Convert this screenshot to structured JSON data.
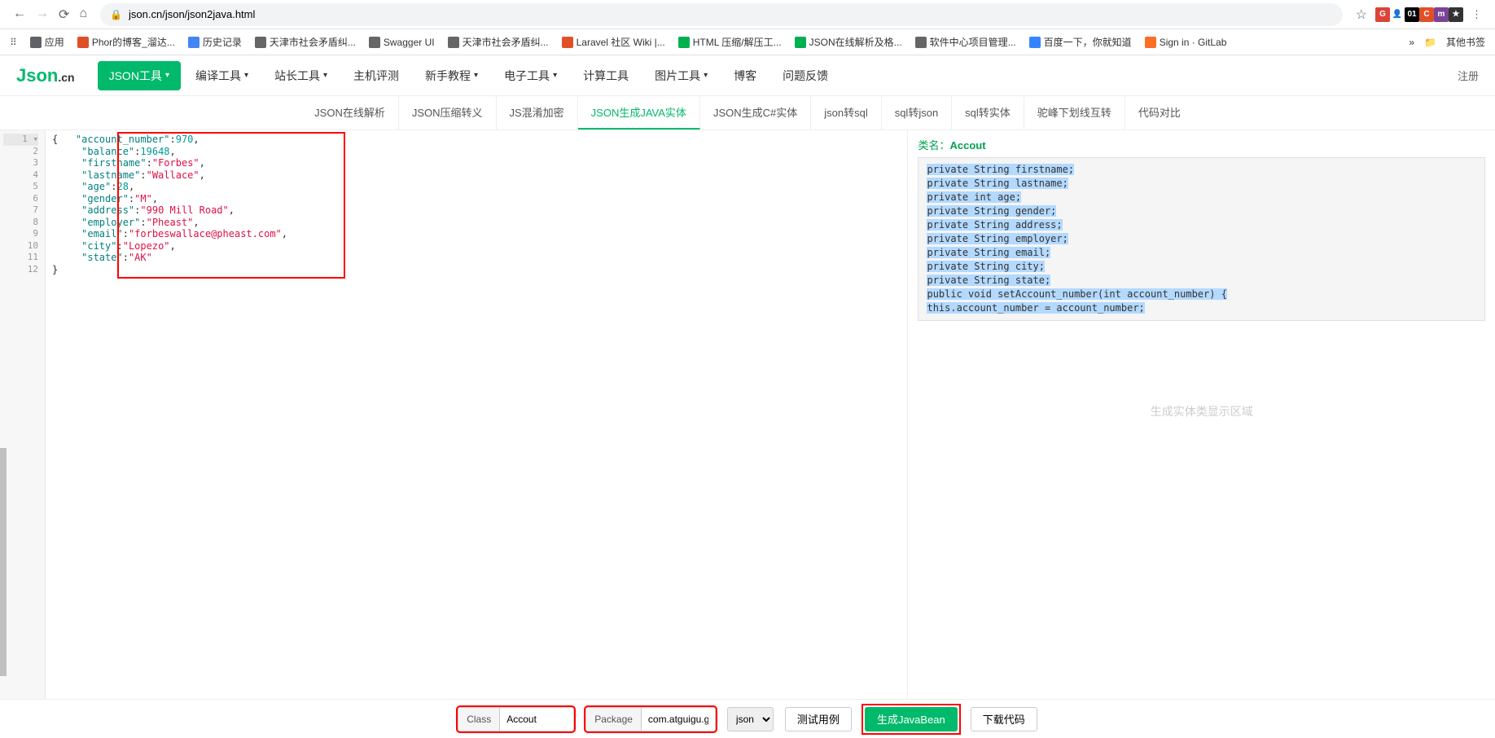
{
  "browser": {
    "url": "json.cn/json/json2java.html",
    "star_icon": "star-icon"
  },
  "extensions": [
    {
      "bg": "#db4437",
      "txt": "G"
    },
    {
      "bg": "#fff",
      "txt": "👤"
    },
    {
      "bg": "#000",
      "txt": "01"
    },
    {
      "bg": "#e05028",
      "txt": "C"
    },
    {
      "bg": "#7b4397",
      "txt": "m"
    },
    {
      "bg": "#333",
      "txt": "★"
    }
  ],
  "bookmarks": [
    {
      "label": "应用",
      "color": "#5f6368"
    },
    {
      "label": "Phor的博客_溜达...",
      "color": "#e05028"
    },
    {
      "label": "历史记录",
      "color": "#4285f4"
    },
    {
      "label": "天津市社会矛盾纠...",
      "color": "#666"
    },
    {
      "label": "Swagger UI",
      "color": "#666"
    },
    {
      "label": "天津市社会矛盾纠...",
      "color": "#666"
    },
    {
      "label": "Laravel 社区 Wiki |...",
      "color": "#e05028"
    },
    {
      "label": "HTML 压缩/解压工...",
      "color": "#00b050"
    },
    {
      "label": "JSON在线解析及格...",
      "color": "#00b050"
    },
    {
      "label": "软件中心项目管理...",
      "color": "#666"
    },
    {
      "label": "百度一下，你就知道",
      "color": "#3385ff"
    },
    {
      "label": "Sign in · GitLab",
      "color": "#fc6d26"
    }
  ],
  "bookmarks_right": {
    "other": "其他书签"
  },
  "nav": {
    "logo_main": "Json",
    "logo_suffix": ".cn",
    "items": [
      {
        "label": "JSON工具",
        "primary": true,
        "caret": true
      },
      {
        "label": "编译工具",
        "caret": true
      },
      {
        "label": "站长工具",
        "caret": true
      },
      {
        "label": "主机评测"
      },
      {
        "label": "新手教程",
        "caret": true
      },
      {
        "label": "电子工具",
        "caret": true
      },
      {
        "label": "计算工具"
      },
      {
        "label": "图片工具",
        "caret": true
      },
      {
        "label": "博客"
      },
      {
        "label": "问题反馈"
      }
    ],
    "register": "注册"
  },
  "sub_tabs": [
    {
      "label": "JSON在线解析"
    },
    {
      "label": "JSON压缩转义"
    },
    {
      "label": "JS混淆加密"
    },
    {
      "label": "JSON生成JAVA实体",
      "active": true
    },
    {
      "label": "JSON生成C#实体"
    },
    {
      "label": "json转sql"
    },
    {
      "label": "sql转json"
    },
    {
      "label": "sql转实体"
    },
    {
      "label": "驼峰下划线互转"
    },
    {
      "label": "代码对比"
    }
  ],
  "editor": {
    "line_count": 12,
    "json_source": {
      "account_number": 970,
      "balance": 19648,
      "firstname": "Forbes",
      "lastname": "Wallace",
      "age": 28,
      "gender": "M",
      "address": "990 Mill Road",
      "employer": "Pheast",
      "email": "forbeswallace@pheast.com",
      "city": "Lopezo",
      "state": "AK"
    }
  },
  "output": {
    "class_label": "类名：",
    "class_name": "Accout",
    "lines": [
      "private String firstname;",
      "private String lastname;",
      "private int age;",
      "private String gender;",
      "private String address;",
      "private String employer;",
      "private String email;",
      "private String city;",
      "private String state;",
      "public void setAccount_number(int account_number) {",
      "     this.account_number = account_number;"
    ],
    "placeholder": "生成实体类显示区域"
  },
  "bottom": {
    "class_label": "Class",
    "class_value": "Accout",
    "package_label": "Package",
    "package_value": "com.atguigu.g",
    "select_value": "json",
    "test_btn": "测试用例",
    "generate_btn": "生成JavaBean",
    "download_btn": "下载代码"
  }
}
